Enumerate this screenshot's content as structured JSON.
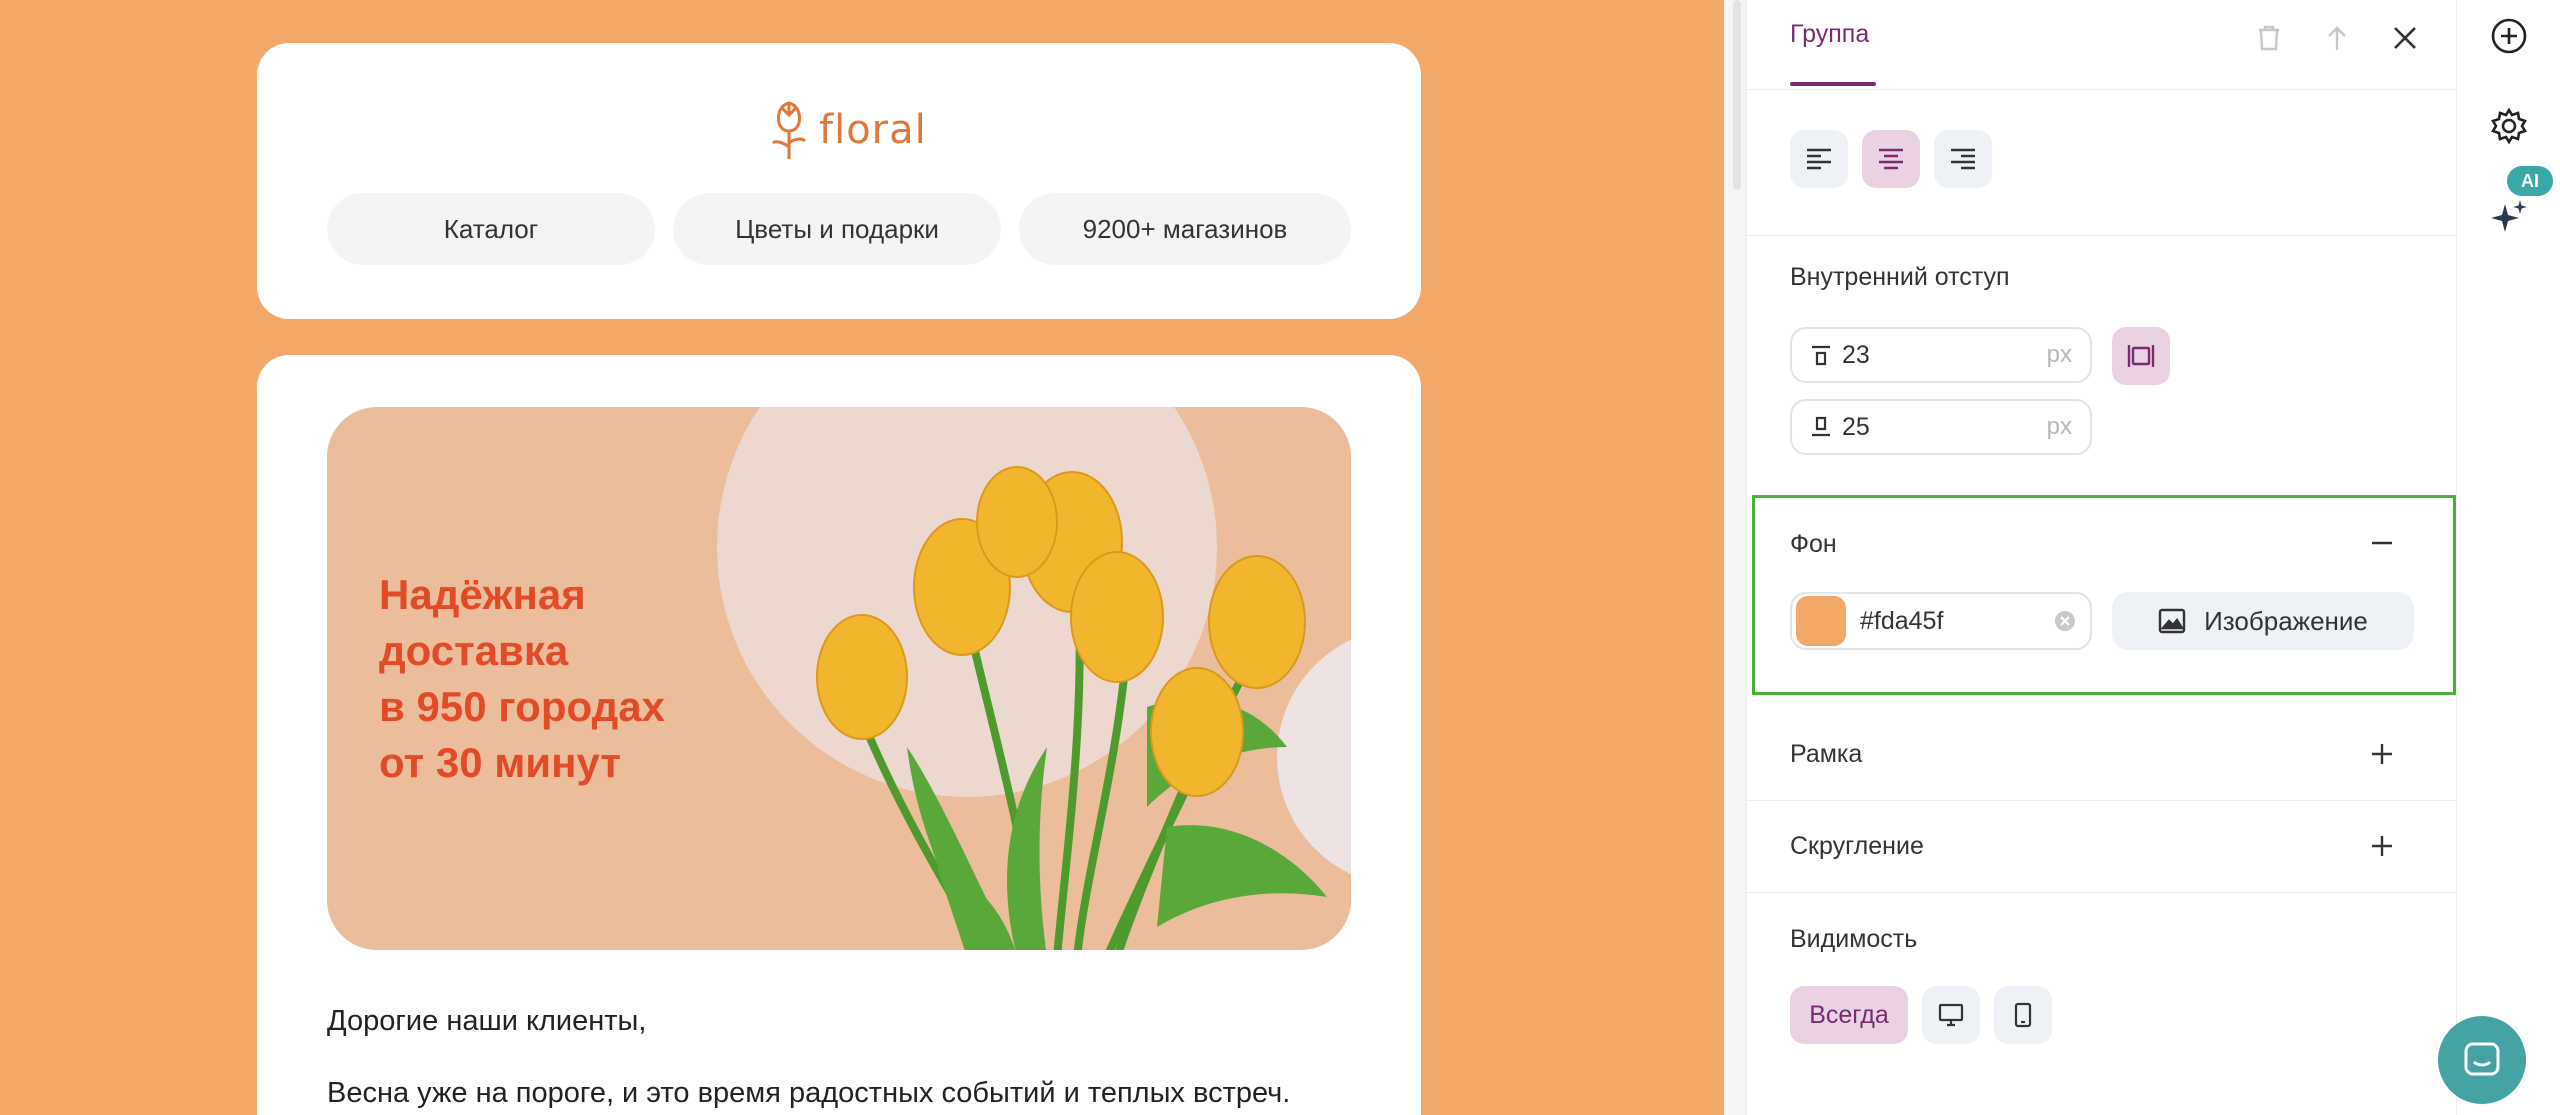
{
  "email": {
    "logo_text": "floral",
    "nav": [
      "Каталог",
      "Цветы и подарки",
      "9200+ магазинов"
    ],
    "banner_lines": [
      "Надёжная",
      "доставка",
      "в 950 городах",
      "от 30 минут"
    ],
    "greeting": "Дорогие наши клиенты,",
    "paragraph": "Весна уже на пороге, и это время радостных событий и теплых встреч."
  },
  "panel": {
    "tab": "Группа",
    "padding_label": "Внутренний отступ",
    "padding_top": "23",
    "padding_bottom": "25",
    "unit": "px",
    "background_label": "Фон",
    "background_color": "#fda45f",
    "image_button": "Изображение",
    "border_label": "Рамка",
    "radius_label": "Скругление",
    "visibility_label": "Видимость",
    "visibility_always": "Всегда"
  },
  "rail": {
    "ai_badge": "AI"
  },
  "colors": {
    "canvas_bg": "#f2a869",
    "accent": "#7a2a6e",
    "banner_text": "#e24a2a",
    "highlight": "#4cae3d",
    "chat": "#46a3a3"
  }
}
